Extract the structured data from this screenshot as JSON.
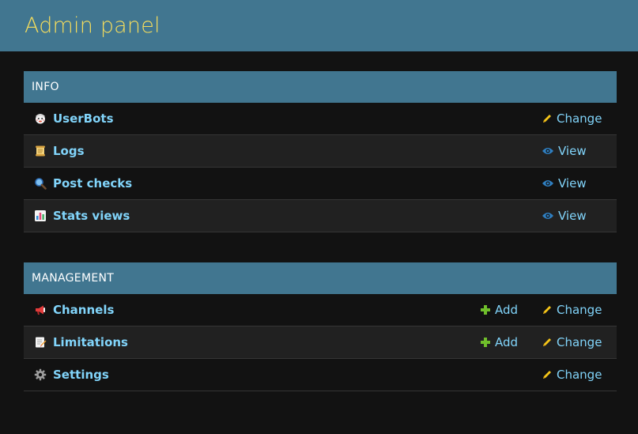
{
  "header": {
    "title": "Admin panel"
  },
  "modules": [
    {
      "caption": "INFO",
      "rows": [
        {
          "label": "UserBots",
          "icon": "bot-face-icon",
          "actions": [
            "change"
          ]
        },
        {
          "label": "Logs",
          "icon": "scroll-icon",
          "actions": [
            "view"
          ]
        },
        {
          "label": "Post checks",
          "icon": "magnifier-icon",
          "actions": [
            "view"
          ]
        },
        {
          "label": "Stats views",
          "icon": "bar-chart-icon",
          "actions": [
            "view"
          ]
        }
      ]
    },
    {
      "caption": "MANAGEMENT",
      "rows": [
        {
          "label": "Channels",
          "icon": "megaphone-icon",
          "actions": [
            "add",
            "change"
          ]
        },
        {
          "label": "Limitations",
          "icon": "memo-icon",
          "actions": [
            "add",
            "change"
          ]
        },
        {
          "label": "Settings",
          "icon": "gear-icon",
          "actions": [
            "change"
          ]
        }
      ]
    }
  ],
  "actions": {
    "change_label": "Change",
    "view_label": "View",
    "add_label": "Add"
  },
  "colors": {
    "header_bg": "#417690",
    "title": "#f5dd5d",
    "link": "#81d4fa",
    "pencil": "#f5c518",
    "add": "#70bf2b",
    "eye": "#2f7fc1"
  }
}
